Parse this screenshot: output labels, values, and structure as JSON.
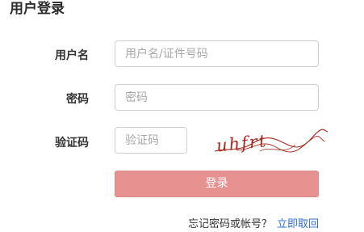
{
  "header": {
    "title": "用户登录"
  },
  "form": {
    "username": {
      "label": "用户名",
      "placeholder": "用户名/证件号码",
      "value": ""
    },
    "password": {
      "label": "密码",
      "placeholder": "密码",
      "value": ""
    },
    "captcha": {
      "label": "验证码",
      "placeholder": "验证码",
      "value": "",
      "image_text": "uhfrt"
    },
    "login_button_label": "登录"
  },
  "footer": {
    "forgot_text": "忘记密码或帐号？",
    "recover_link": "立即取回"
  },
  "colors": {
    "login_button": "#e79191",
    "link": "#2c6fd1",
    "captcha_ink": "#a52a1e"
  }
}
